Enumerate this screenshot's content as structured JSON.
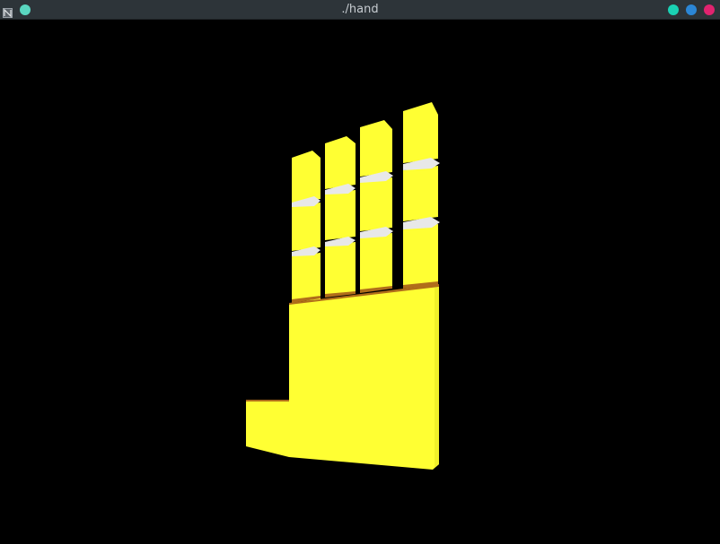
{
  "window": {
    "title": "./hand",
    "app_icon": "app-icon",
    "left_dot_color": "#5ad6c0",
    "right_dots": [
      {
        "name": "minimize-button",
        "color": "#1ad1b4"
      },
      {
        "name": "maximize-button",
        "color": "#2b86d6"
      },
      {
        "name": "close-button",
        "color": "#e0236f"
      }
    ]
  },
  "scene": {
    "background": "#000000",
    "hand_color": "#ffff33",
    "hand_shade": "#e6e620",
    "joint_color": "#e8e8e8",
    "edge_color": "#b06d1a"
  }
}
